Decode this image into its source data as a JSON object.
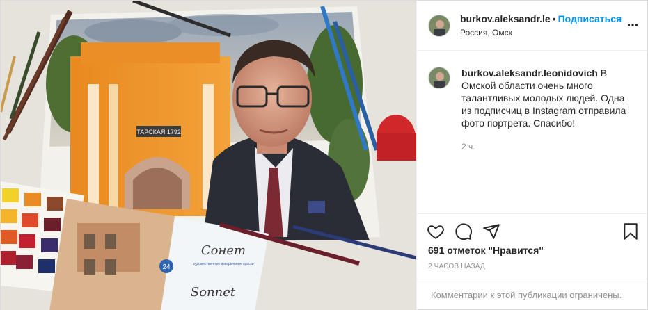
{
  "post": {
    "author": "burkov.aleksandr.le",
    "dot": "•",
    "follow_label": "Подписаться",
    "location": "Россия, Омск",
    "more_icon": "more-horizontal-icon"
  },
  "caption": {
    "author": "burkov.aleksandr.leonidovich",
    "text": " В Омской области очень много талантливых молодых людей. Одна из подписчиц в Instagram отправила фото портрета. Спасибо!",
    "time": "2 ч."
  },
  "actions": {
    "like_icon": "heart-icon",
    "comment_icon": "comment-icon",
    "share_icon": "share-icon",
    "save_icon": "bookmark-icon"
  },
  "likes": "691 отметок \"Нравится\"",
  "posted": "2 часов назад",
  "comments_disabled": "Комментарии к этой публикации ограничены.",
  "image": {
    "sign": "ТАРСКАЯ 1792",
    "brand": "Сонет",
    "brand_sub": "художественные акварельные краски",
    "brand_latin": "Sonnet",
    "count": "24"
  }
}
